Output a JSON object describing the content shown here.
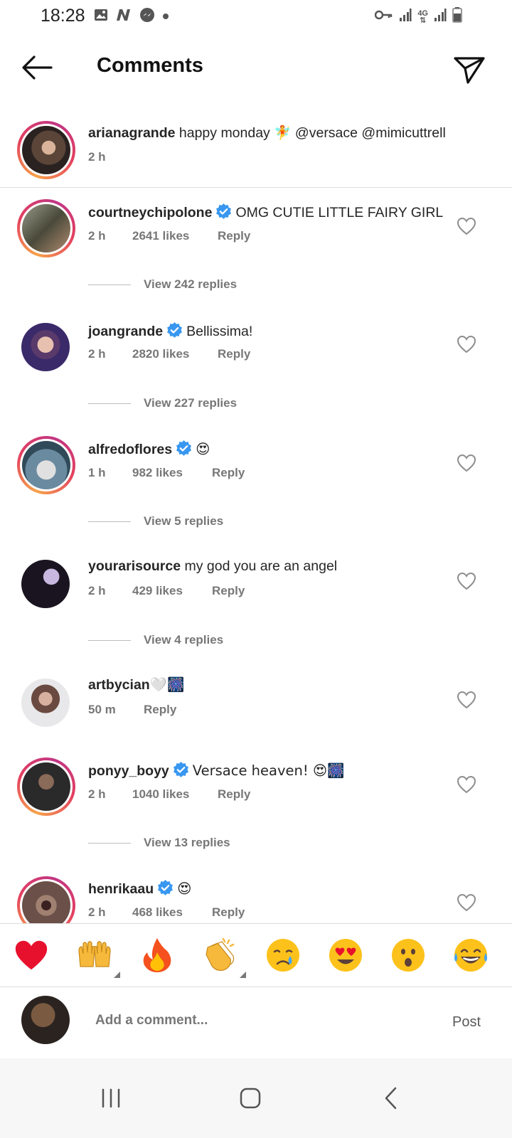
{
  "status_bar": {
    "time": "18:28",
    "network_label": "4G"
  },
  "header": {
    "title": "Comments"
  },
  "caption": {
    "username": "arianagrande",
    "text": "happy monday 🧚 @versace @mimicuttrell",
    "time": "2 h"
  },
  "comments": [
    {
      "username": "courtneychipolone",
      "verified": true,
      "text": "OMG CUTIE LITTLE FAIRY GIRL",
      "time": "2 h",
      "likes": "2641 likes",
      "reply_label": "Reply",
      "view_replies": "View 242 replies"
    },
    {
      "username": "joangrande",
      "verified": true,
      "text": "Bellissima!",
      "time": "2 h",
      "likes": "2820 likes",
      "reply_label": "Reply",
      "view_replies": "View 227 replies"
    },
    {
      "username": "alfredoflores",
      "verified": true,
      "text": "😍",
      "time": "1 h",
      "likes": "982 likes",
      "reply_label": "Reply",
      "view_replies": "View 5 replies"
    },
    {
      "username": "yourarisource",
      "verified": false,
      "text": "my god you are an angel",
      "time": "2 h",
      "likes": "429 likes",
      "reply_label": "Reply",
      "view_replies": "View 4 replies"
    },
    {
      "username": "artbycian",
      "verified": false,
      "text": "🤍🎆",
      "time": "50 m",
      "likes": "",
      "reply_label": "Reply",
      "view_replies": ""
    },
    {
      "username": "ponyy_boyy",
      "verified": true,
      "text": "Versace heaven! 😍🎆",
      "time": "2 h",
      "likes": "1040 likes",
      "reply_label": "Reply",
      "view_replies": "View 13 replies"
    },
    {
      "username": "henrikaau",
      "verified": true,
      "text": "😍",
      "time": "2 h",
      "likes": "468 likes",
      "reply_label": "Reply",
      "view_replies": ""
    }
  ],
  "reactions": [
    "❤️",
    "🙌",
    "🔥",
    "👏",
    "😢",
    "😍",
    "😮",
    "😂"
  ],
  "composer": {
    "placeholder": "Add a comment...",
    "post_label": "Post"
  },
  "colors": {
    "verified": "#3897f0",
    "ring_start": "#f7a34b",
    "ring_end": "#c13584",
    "muted_text": "#777777"
  }
}
